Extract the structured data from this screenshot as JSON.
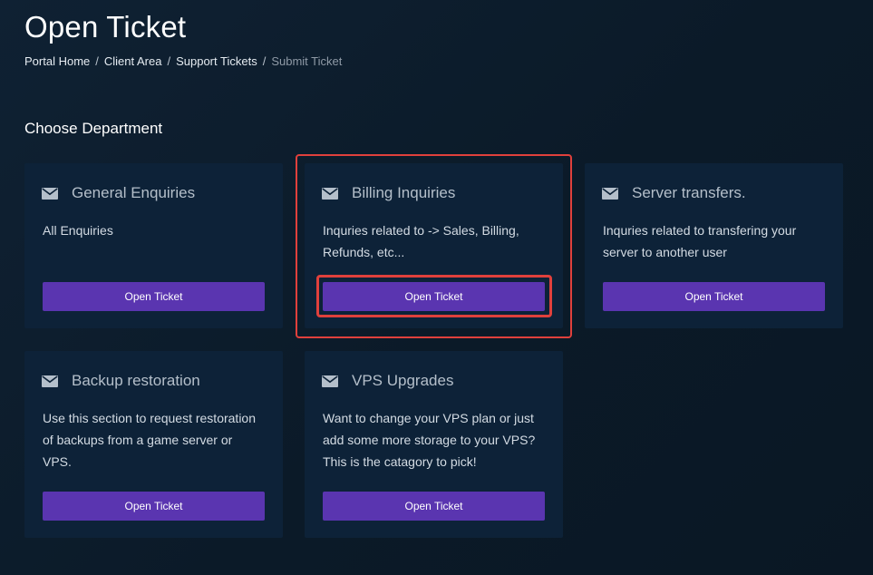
{
  "page": {
    "title": "Open Ticket"
  },
  "breadcrumb": {
    "items": [
      "Portal Home",
      "Client Area",
      "Support Tickets"
    ],
    "current": "Submit Ticket",
    "separator": "/"
  },
  "section": {
    "title": "Choose Department"
  },
  "departments": [
    {
      "title": "General Enquiries",
      "description": "All Enquiries",
      "button_label": "Open Ticket",
      "icon": "envelope-icon"
    },
    {
      "title": "Billing Inquiries",
      "description": "Inquries related to -> Sales, Billing, Refunds, etc...",
      "button_label": "Open Ticket",
      "icon": "envelope-icon",
      "highlighted": true
    },
    {
      "title": "Server transfers.",
      "description": "Inquries related to transfering your server to another user",
      "button_label": "Open Ticket",
      "icon": "envelope-icon"
    },
    {
      "title": "Backup restoration",
      "description": "Use this section to request restoration of backups from a game server or VPS.",
      "button_label": "Open Ticket",
      "icon": "envelope-icon"
    },
    {
      "title": "VPS Upgrades",
      "description": "Want to change your VPS plan or just add some more storage to your VPS? This is the catagory to pick!",
      "button_label": "Open Ticket",
      "icon": "envelope-icon"
    }
  ],
  "colors": {
    "background": "#0c1b2a",
    "card": "#0d2238",
    "button": "#5a35b0",
    "highlight": "#e0403c"
  }
}
